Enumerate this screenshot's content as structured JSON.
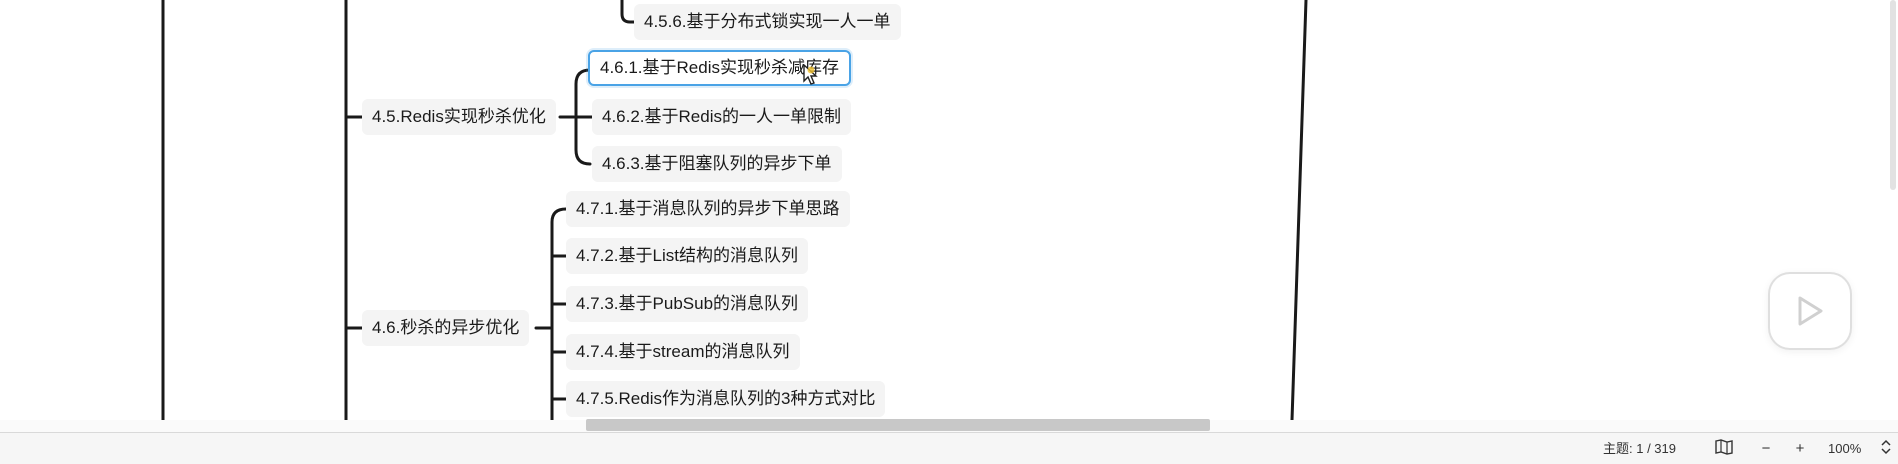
{
  "mindmap": {
    "nodes": {
      "n456": "4.5.6.基于分布式锁实现一人一单",
      "n45": "4.5.Redis实现秒杀优化",
      "n461": "4.6.1.基于Redis实现秒杀减库存",
      "n462": "4.6.2.基于Redis的一人一单限制",
      "n463": "4.6.3.基于阻塞队列的异步下单",
      "n46": "4.6.秒杀的异步优化",
      "n471": "4.7.1.基于消息队列的异步下单思路",
      "n472": "4.7.2.基于List结构的消息队列",
      "n473": "4.7.3.基于PubSub的消息队列",
      "n474": "4.7.4.基于stream的消息队列",
      "n475": "4.7.5.Redis作为消息队列的3种方式对比"
    },
    "selected_node": "4.6.1.基于Redis实现秒杀减库存"
  },
  "statusbar": {
    "topic_count": "主题: 1 / 319",
    "zoom": "100%",
    "zoom_out_label": "−",
    "zoom_in_label": "+",
    "map_icon": "map-icon",
    "stepper_icon": "up-down-stepper-icon"
  },
  "overlay": {
    "play_icon": "play-icon"
  },
  "colors": {
    "selection": "#4aa3e6",
    "node_bg": "#f4f4f4",
    "line": "#1a1a1a"
  }
}
